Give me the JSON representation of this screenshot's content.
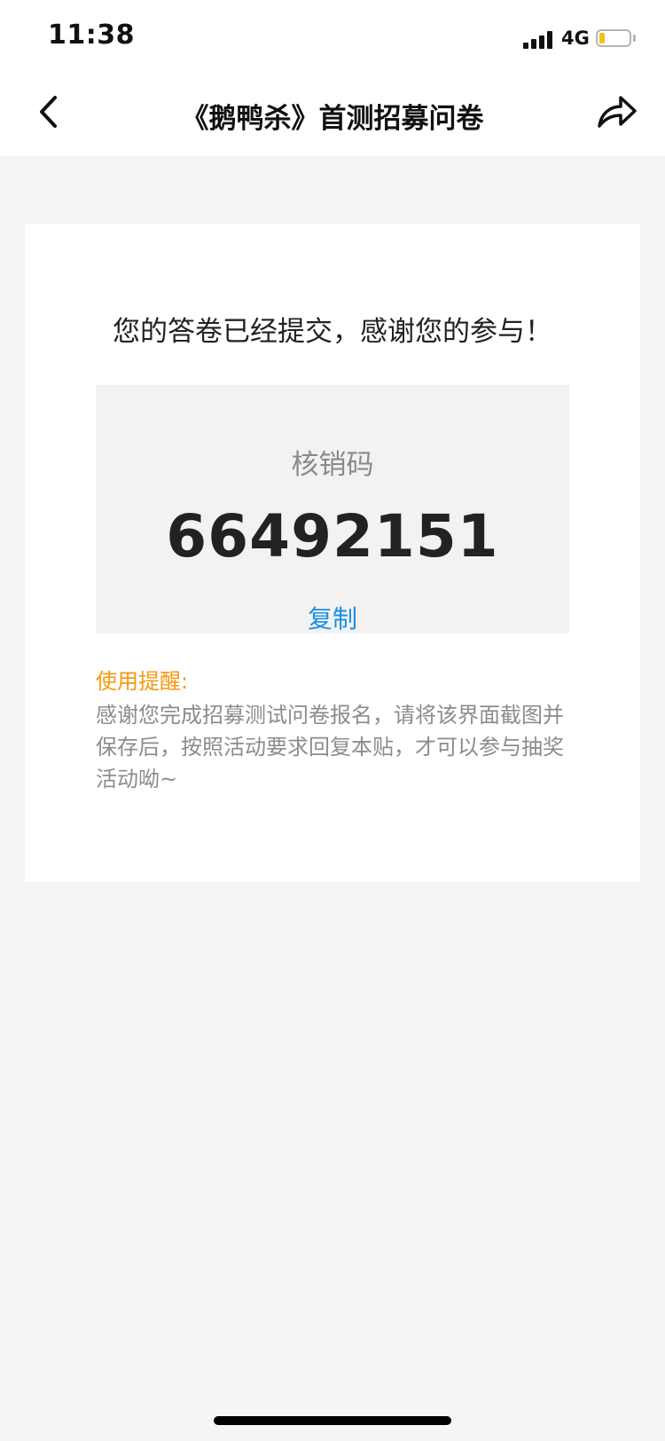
{
  "status_bar": {
    "time": "11:38",
    "network": "4G",
    "signal_icon": "cellular-signal-icon",
    "battery_icon": "battery-icon",
    "battery_level": 0.2,
    "battery_color": "#f2c21b"
  },
  "nav": {
    "title": "《鹅鸭杀》首测招募问卷",
    "back_icon": "chevron-left-icon",
    "share_icon": "share-arrow-icon"
  },
  "card": {
    "success_message": "您的答卷已经提交，感谢您的参与！",
    "code": {
      "label": "核销码",
      "value": "66492151",
      "copy_label": "复制",
      "copy_color": "#1a8fe3"
    },
    "reminder": {
      "title": "使用提醒:",
      "body": "感谢您完成招募测试问卷报名，请将该界面截图并保存后，按照活动要求回复本贴，才可以参与抽奖活动呦~",
      "title_color": "#f39a0e"
    }
  }
}
